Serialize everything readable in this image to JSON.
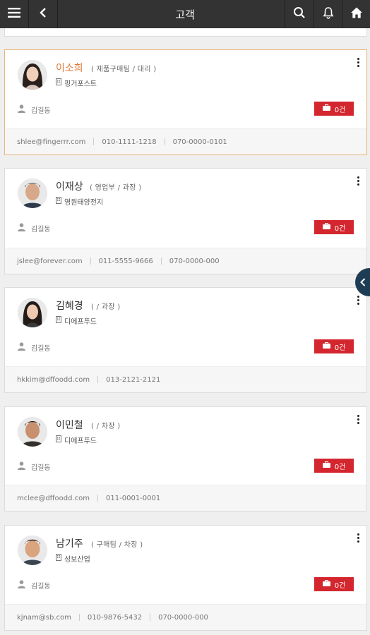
{
  "header": {
    "title": "고객",
    "menu_icon": "menu-icon",
    "back_icon": "chevron-left-icon",
    "search_icon": "search-icon",
    "bell_icon": "bell-icon",
    "home_icon": "home-icon"
  },
  "accent_colors": {
    "topbar": "#333333",
    "selected_border": "#e8b47c",
    "selected_name": "#e07b39",
    "badge": "#d3262e",
    "side_tab": "#1e3d55"
  },
  "cards": [
    {
      "name": "이소희",
      "dept": "( 제품구매팀 / 대리 )",
      "company": "핑거포스트",
      "owner": "김길동",
      "badge": "0건",
      "email": "shlee@fingerrr.com",
      "phone": "010-1111-1218",
      "tel": "070-0000-0101"
    },
    {
      "name": "이재상",
      "dept": "( 영업부 / 과장 )",
      "company": "영원태양전지",
      "owner": "김길동",
      "badge": "0건",
      "email": "jslee@forever.com",
      "phone": "011-5555-9666",
      "tel": "070-0000-000"
    },
    {
      "name": "김혜경",
      "dept": "( / 과장 )",
      "company": "디에프푸드",
      "owner": "김길동",
      "badge": "0건",
      "email": "hkkim@dffoodd.com",
      "phone": "013-2121-2121",
      "tel": ""
    },
    {
      "name": "이민철",
      "dept": "( / 차장 )",
      "company": "디에프푸드",
      "owner": "김길동",
      "badge": "0건",
      "email": "mclee@dffoodd.com",
      "phone": "011-0001-0001",
      "tel": ""
    },
    {
      "name": "남기주",
      "dept": "( 구매팀 / 차장 )",
      "company": "성보산업",
      "owner": "김길동",
      "badge": "0건",
      "email": "kjnam@sb.com",
      "phone": "010-9876-5432",
      "tel": "070-0000-000"
    }
  ]
}
